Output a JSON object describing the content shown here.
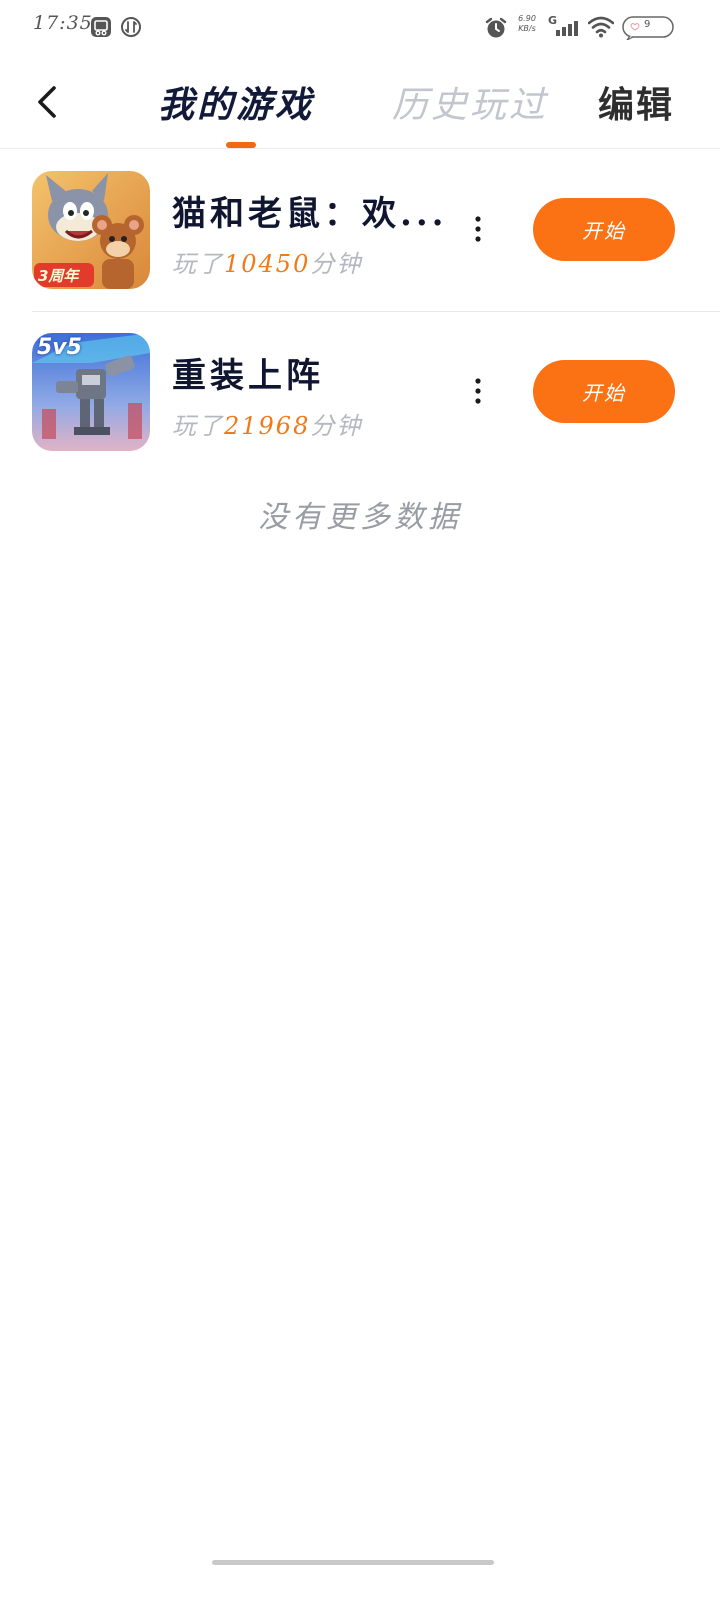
{
  "status_bar": {
    "time": "17:35",
    "net_speed_value": "6.90",
    "net_speed_unit": "KB/s",
    "network_type": "G",
    "battery_level": "9",
    "icons": [
      "screenshot-app-icon",
      "data-saver-icon",
      "alarm-icon",
      "signal-icon",
      "wifi-icon",
      "battery-icon"
    ]
  },
  "header": {
    "tabs": [
      {
        "label": "我的游戏",
        "active": true
      },
      {
        "label": "历史玩过",
        "active": false
      }
    ],
    "edit_label": "编辑",
    "accent_color": "#f06a12"
  },
  "games": [
    {
      "title": "猫和老鼠：欢...",
      "playtime_prefix": "玩了",
      "playtime_minutes": "10450",
      "playtime_suffix": "分钟",
      "start_label": "开始",
      "icon_badge": "3周年"
    },
    {
      "title": "重装上阵",
      "playtime_prefix": "玩了",
      "playtime_minutes": "21968",
      "playtime_suffix": "分钟",
      "start_label": "开始",
      "icon_badge": "5v5"
    }
  ],
  "footer": {
    "no_more_text": "没有更多数据"
  },
  "colors": {
    "start_button": "#fb7214",
    "playtime_number": "#f07a1a",
    "title": "#101530",
    "inactive_tab": "#c4c6cf"
  }
}
